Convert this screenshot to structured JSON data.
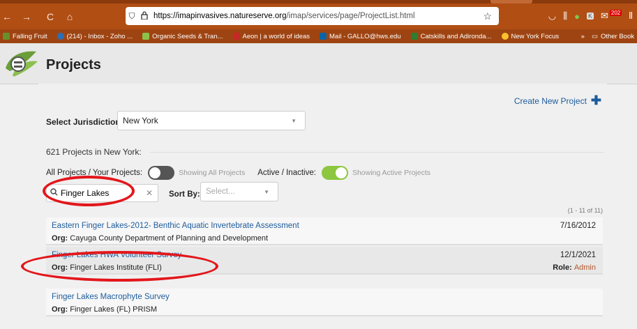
{
  "browser": {
    "nav": {
      "back": "←",
      "forward": "→",
      "reload": "C",
      "home": "⌂",
      "reader": "⚐"
    },
    "url_host": "https://imapinvasives.natureserve.org",
    "url_rest": "/imap/services/page/ProjectList.html",
    "notification_count": "202",
    "bookmarks": [
      {
        "label": "Falling Fruit",
        "color": "#6a8f2a"
      },
      {
        "label": "(214) - Inbox - Zoho ...",
        "color": "#2d6fb5"
      },
      {
        "label": "Organic Seeds & Tran...",
        "color": "#8bc34a"
      },
      {
        "label": "Aeon | a world of ideas",
        "color": "#c62828"
      },
      {
        "label": "Mail - GALLO@hws.edu",
        "color": "#0a64a4"
      },
      {
        "label": "Catskills and Adironda...",
        "color": "#2e7d32"
      },
      {
        "label": "New York Focus",
        "color": "#fbc02d"
      }
    ],
    "other_bookmarks": "Other Book"
  },
  "header": {
    "title": "Projects"
  },
  "actions": {
    "create_new": "Create New Project"
  },
  "filters": {
    "jurisdiction_label": "Select Jurisdiction:",
    "jurisdiction_value": "New York",
    "project_count": "621 Projects in New York:",
    "all_your_label": "All Projects / Your Projects:",
    "all_your_state": "Showing All Projects",
    "active_label": "Active / Inactive:",
    "active_state": "Showing Active Projects",
    "search_value": "Finger Lakes",
    "sort_label": "Sort By:",
    "sort_placeholder": "Select...",
    "range": "(1 - 11 of 11)"
  },
  "projects": [
    {
      "name": "Eastern Finger Lakes-2012- Benthic Aquatic Invertebrate Assessment",
      "org_label": "Org:",
      "org": "Cayuga County Department of Planning and Development",
      "date": "7/16/2012",
      "role_label": "",
      "role": ""
    },
    {
      "name": "Finger Lakes HWA Volunteer Survey",
      "org_label": "Org:",
      "org": "Finger Lakes Institute (FLI)",
      "date": "12/1/2021",
      "role_label": "Role:",
      "role": "Admin"
    },
    {
      "name": "Finger Lakes Macrophyte Survey",
      "org_label": "Org:",
      "org": "Finger Lakes (FL) PRISM",
      "date": "",
      "role_label": "",
      "role": ""
    }
  ],
  "colors": {
    "browser_bar": "#b04e14",
    "link": "#1d5c9c",
    "toggle_on": "#8dc63f",
    "toggle_off": "#555555",
    "annotation": "#e3161b",
    "role_value": "#b3572b"
  }
}
